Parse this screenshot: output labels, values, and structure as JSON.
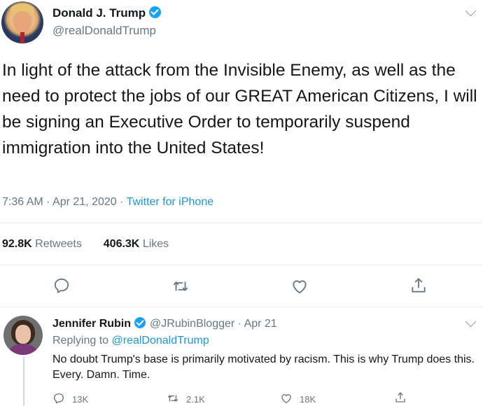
{
  "tweet": {
    "author_name": "Donald J. Trump",
    "author_handle": "@realDonaldTrump",
    "text": "In light of the attack from the Invisible Enemy, as well as the need to protect the jobs of our GREAT American Citizens, I will be signing an Executive Order to temporarily suspend immigration into the United States!",
    "timestamp": "7:36 AM · Apr 21, 2020",
    "separator": " · ",
    "source": "Twitter for iPhone",
    "retweets_count": "92.8K",
    "retweets_label": "Retweets",
    "likes_count": "406.3K",
    "likes_label": "Likes"
  },
  "reply": {
    "author_name": "Jennifer Rubin",
    "author_handle": "@JRubinBlogger",
    "date": "· Apr 21",
    "replying_prefix": "Replying to",
    "replying_handle": "@realDonaldTrump",
    "text": "No doubt Trump's base is primarily motivated by racism. This is why Trump does this. Every. Damn. Time.",
    "reply_count": "13K",
    "retweet_count": "2.1K",
    "like_count": "18K"
  },
  "icons": {
    "verified": "verified-badge-icon",
    "menu": "chevron-down-icon",
    "reply": "reply-icon",
    "retweet": "retweet-icon",
    "like": "heart-icon",
    "share": "share-icon"
  },
  "colors": {
    "link": "#1b95e0",
    "secondary_text": "#657786",
    "verified": "#1da1f2"
  }
}
